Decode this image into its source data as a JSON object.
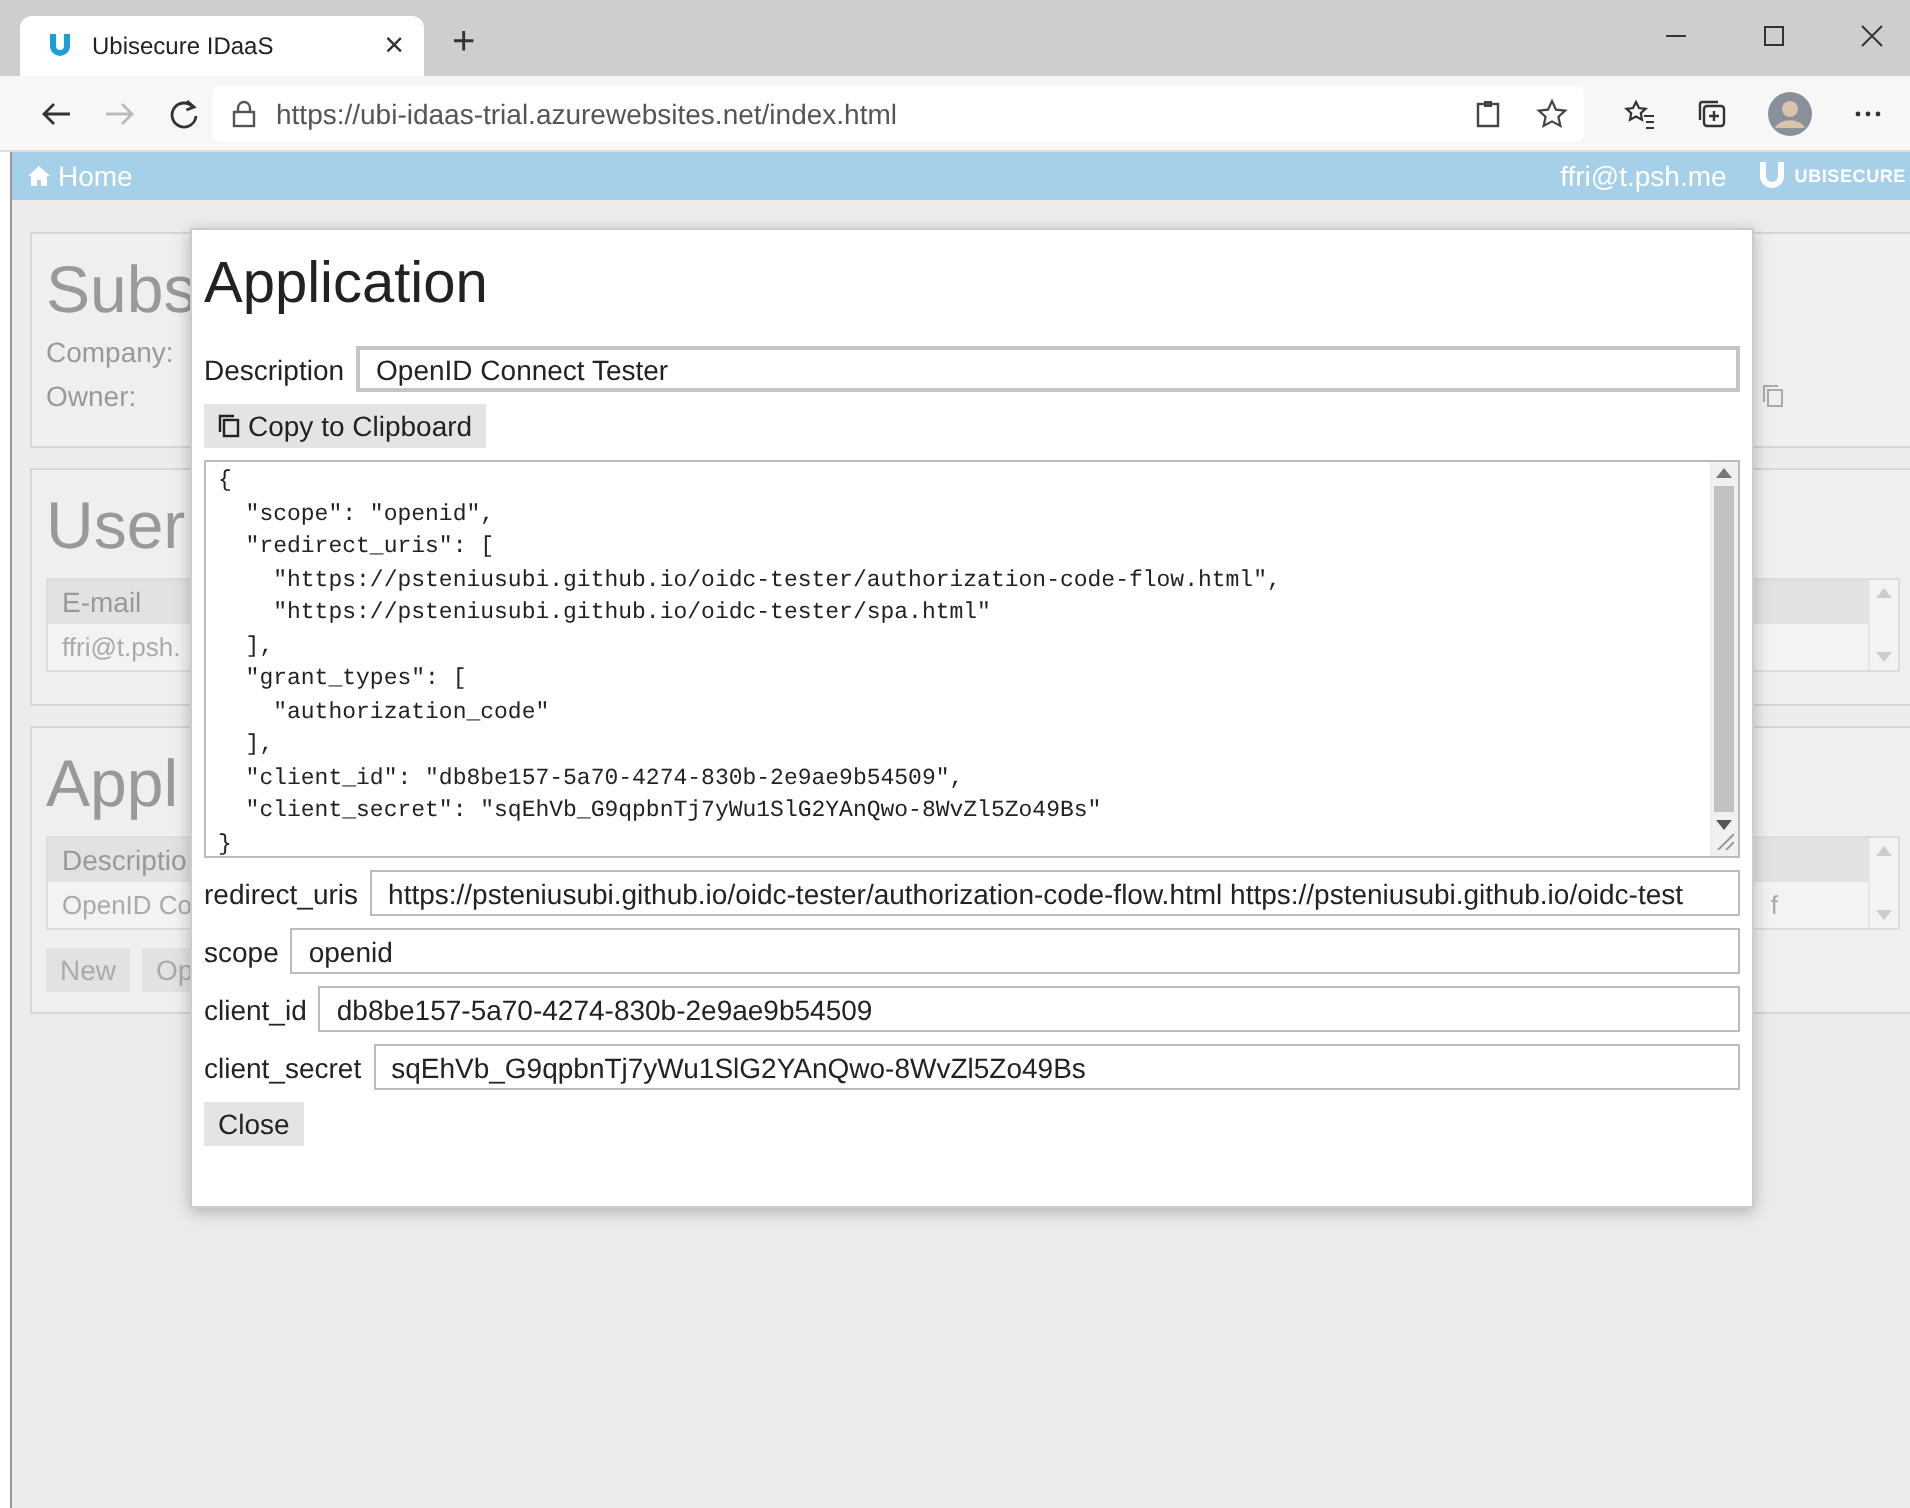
{
  "browser": {
    "tab_title": "Ubisecure IDaaS",
    "tab_close": "×",
    "new_tab": "+",
    "url": "https://ubi-idaas-trial.azurewebsites.net/index.html"
  },
  "navbar": {
    "home": "Home",
    "user": "ffri@t.psh.me",
    "logo": "UBISECURE"
  },
  "background": {
    "subscription": {
      "title": "Subs",
      "fields": [
        "Company:",
        "Owner:"
      ]
    },
    "users": {
      "title": "User",
      "columns": [
        "E-mail"
      ],
      "rows": [
        [
          "ffri@t.psh."
        ]
      ]
    },
    "applications": {
      "title": "Appl",
      "columns": [
        "Descriptio"
      ],
      "rows": [
        [
          "OpenID Co",
          "f"
        ]
      ],
      "buttons": [
        "New",
        "Op"
      ]
    }
  },
  "dialog": {
    "title": "Application",
    "description": {
      "label": "Description",
      "value": "OpenID Connect Tester"
    },
    "copy_button": "Copy to Clipboard",
    "json_lines": [
      "{",
      "  \"scope\": \"openid\",",
      "  \"redirect_uris\": [",
      "    \"https://psteniusubi.github.io/oidc-tester/authorization-code-flow.html\",",
      "    \"https://psteniusubi.github.io/oidc-tester/spa.html\"",
      "  ],",
      "  \"grant_types\": [",
      "    \"authorization_code\"",
      "  ],",
      "  \"client_id\": \"db8be157-5a70-4274-830b-2e9ae9b54509\",",
      "  \"client_secret\": \"sqEhVb_G9qpbnTj7yWu1SlG2YAnQwo-8WvZl5Zo49Bs\"",
      "}"
    ],
    "fields": [
      {
        "label": "redirect_uris",
        "value": "https://psteniusubi.github.io/oidc-tester/authorization-code-flow.html https://psteniusubi.github.io/oidc-test"
      },
      {
        "label": "scope",
        "value": "openid"
      },
      {
        "label": "client_id",
        "value": "db8be157-5a70-4274-830b-2e9ae9b54509"
      },
      {
        "label": "client_secret",
        "value": "sqEhVb_G9qpbnTj7yWu1SlG2YAnQwo-8WvZl5Zo49Bs"
      }
    ],
    "close_button": "Close"
  }
}
